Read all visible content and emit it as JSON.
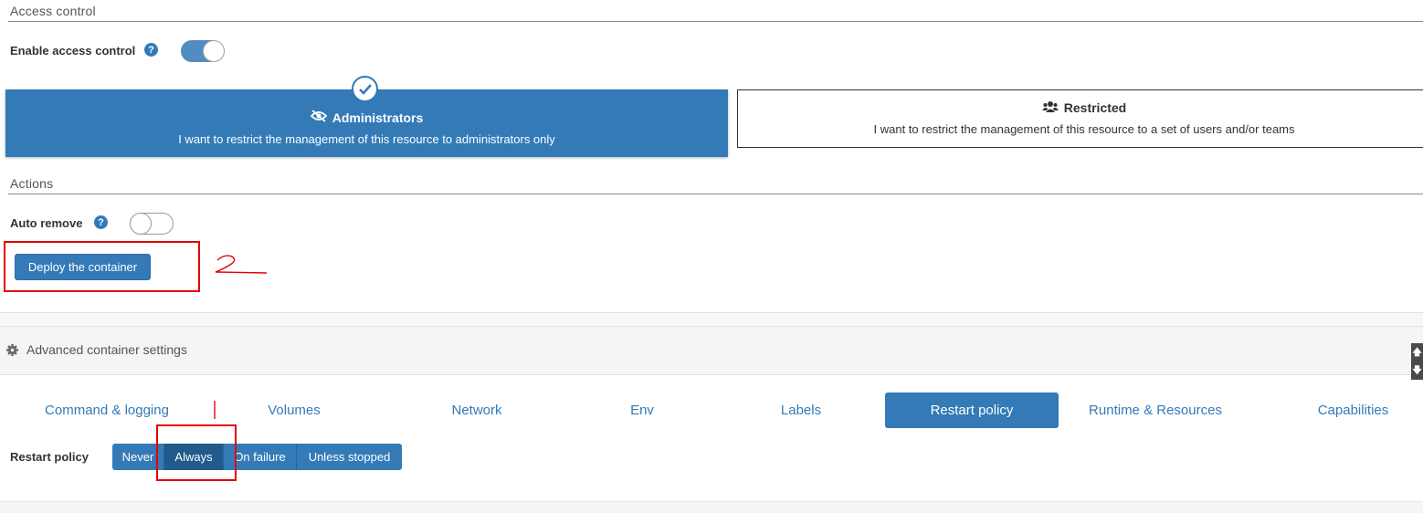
{
  "access_control": {
    "section_title": "Access control",
    "enable_label": "Enable access control",
    "help_glyph": "?",
    "enabled": true,
    "options": {
      "administrators": {
        "title": "Administrators",
        "description": "I want to restrict the management of this resource to administrators only",
        "icon": "eye-slash-icon",
        "selected": true
      },
      "restricted": {
        "title": "Restricted",
        "description": "I want to restrict the management of this resource to a set of users and/or teams",
        "icon": "users-icon",
        "selected": false
      }
    }
  },
  "actions": {
    "section_title": "Actions",
    "auto_remove_label": "Auto remove",
    "help_glyph": "?",
    "auto_remove": false,
    "deploy_label": "Deploy the container"
  },
  "annotations": {
    "mark_1": "1",
    "mark_2": "2",
    "color": "#e60000"
  },
  "advanced": {
    "title": "Advanced container settings",
    "tabs": [
      {
        "label": "Command & logging"
      },
      {
        "label": "Volumes"
      },
      {
        "label": "Network"
      },
      {
        "label": "Env"
      },
      {
        "label": "Labels"
      },
      {
        "label": "Restart policy",
        "active": true
      },
      {
        "label": "Runtime & Resources"
      },
      {
        "label": "Capabilities"
      }
    ],
    "restart_policy": {
      "label": "Restart policy",
      "options": [
        "Never",
        "Always",
        "On failure",
        "Unless stopped"
      ],
      "selected": "Always"
    }
  },
  "colors": {
    "primary": "#337ab7",
    "primary_dark": "#235a8c",
    "annotation_red": "#e60000"
  }
}
